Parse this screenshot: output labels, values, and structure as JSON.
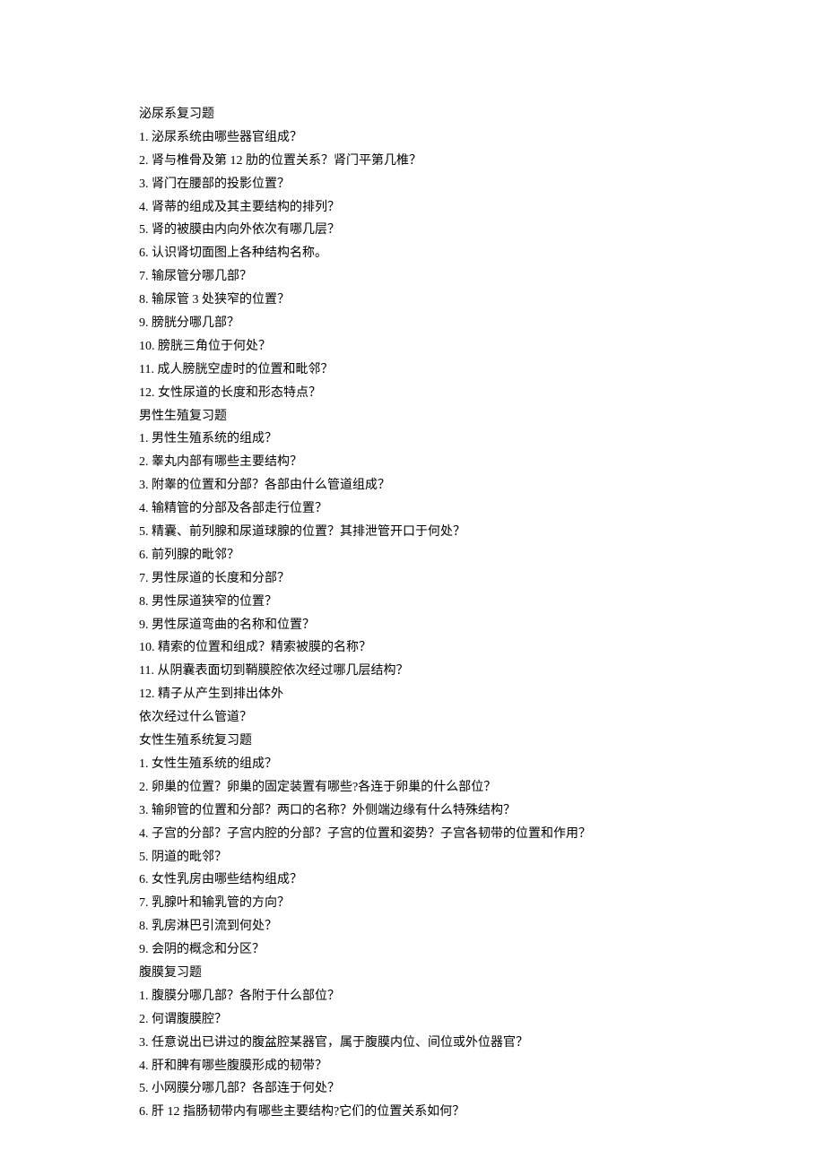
{
  "sections": [
    {
      "heading": "泌尿系复习题",
      "items": [
        "1. 泌尿系统由哪些器官组成？",
        "2. 肾与椎骨及第 12 肋的位置关系？肾门平第几椎？",
        "3. 肾门在腰部的投影位置？",
        "4. 肾蒂的组成及其主要结构的排列？",
        "5. 肾的被膜由内向外依次有哪几层？",
        "6. 认识肾切面图上各种结构名称。",
        "7. 输尿管分哪几部？",
        "8. 输尿管 3 处狭窄的位置？",
        "9. 膀胱分哪几部？",
        "10. 膀胱三角位于何处？",
        "11. 成人膀胱空虚时的位置和毗邻？",
        "12. 女性尿道的长度和形态特点？"
      ]
    },
    {
      "heading": "男性生殖复习题",
      "items": [
        "1. 男性生殖系统的组成？",
        "2. 睾丸内部有哪些主要结构？",
        "3. 附睾的位置和分部？各部由什么管道组成？",
        "4. 输精管的分部及各部走行位置？",
        "5. 精囊、前列腺和尿道球腺的位置？其排泄管开口于何处？",
        "6. 前列腺的毗邻？",
        "7. 男性尿道的长度和分部？",
        "8. 男性尿道狭窄的位置？",
        "9. 男性尿道弯曲的名称和位置？",
        "10. 精索的位置和组成？精索被膜的名称？",
        "11. 从阴囊表面切到鞘膜腔依次经过哪几层结构？",
        "12. 精子从产生到排出体外",
        "依次经过什么管道？"
      ]
    },
    {
      "heading": "女性生殖系统复习题",
      "items": [
        "1. 女性生殖系统的组成？",
        "2. 卵巢的位置？卵巢的固定装置有哪些?各连于卵巢的什么部位？",
        "3. 输卵管的位置和分部？两口的名称？外侧端边缘有什么特殊结构？",
        "4. 子宫的分部？子宫内腔的分部？子宫的位置和姿势？子宫各韧带的位置和作用？",
        "5. 阴道的毗邻？",
        "6. 女性乳房由哪些结构组成？",
        "7. 乳腺叶和输乳管的方向？",
        "8. 乳房淋巴引流到何处？",
        "9. 会阴的概念和分区？"
      ]
    },
    {
      "heading": "腹膜复习题",
      "items": [
        "1. 腹膜分哪几部？各附于什么部位？",
        "2. 何谓腹膜腔？",
        "3. 任意说出已讲过的腹盆腔某器官，属于腹膜内位、间位或外位器官？",
        "4. 肝和脾有哪些腹膜形成的韧带？",
        "5. 小网膜分哪几部？各部连于何处？",
        "6. 肝 12 指肠韧带内有哪些主要结构?它们的位置关系如何？"
      ]
    }
  ]
}
